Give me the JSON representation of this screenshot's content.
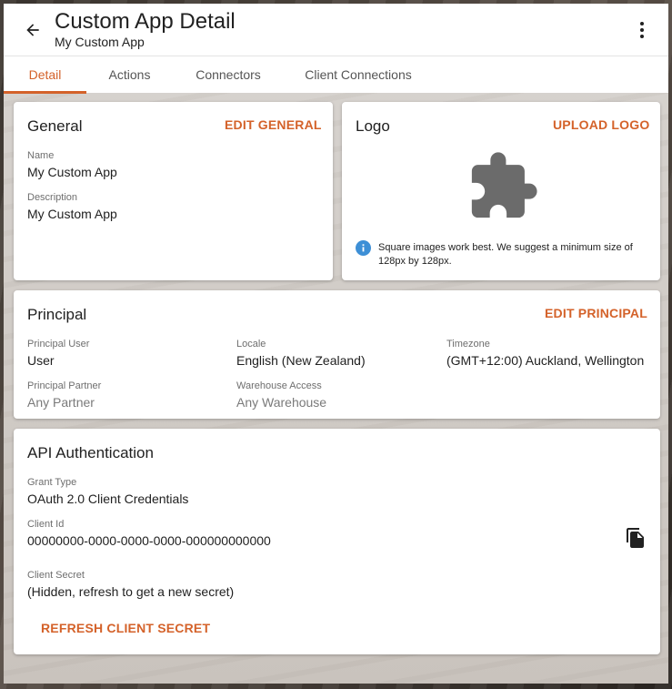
{
  "header": {
    "title": "Custom App Detail",
    "subtitle": "My Custom App"
  },
  "tabs": [
    {
      "label": "Detail",
      "active": true
    },
    {
      "label": "Actions",
      "active": false
    },
    {
      "label": "Connectors",
      "active": false
    },
    {
      "label": "Client Connections",
      "active": false
    }
  ],
  "general": {
    "title": "General",
    "action": "EDIT GENERAL",
    "name_label": "Name",
    "name_value": "My Custom App",
    "description_label": "Description",
    "description_value": "My Custom App"
  },
  "logo": {
    "title": "Logo",
    "action": "UPLOAD LOGO",
    "placeholder_icon": "extension-puzzle-icon",
    "hint": "Square images work best. We suggest a minimum size of 128px by 128px."
  },
  "principal": {
    "title": "Principal",
    "action": "EDIT PRINCIPAL",
    "user_label": "Principal User",
    "user_value": "User",
    "locale_label": "Locale",
    "locale_value": "English (New Zealand)",
    "timezone_label": "Timezone",
    "timezone_value": "(GMT+12:00) Auckland, Wellington",
    "partner_label": "Principal Partner",
    "partner_value": "Any Partner",
    "warehouse_label": "Warehouse Access",
    "warehouse_value": "Any Warehouse"
  },
  "api": {
    "title": "API Authentication",
    "grant_label": "Grant Type",
    "grant_value": "OAuth 2.0 Client Credentials",
    "client_id_label": "Client Id",
    "client_id_value": "00000000-0000-0000-0000-000000000000",
    "secret_label": "Client Secret",
    "secret_value": "(Hidden, refresh to get a new secret)",
    "refresh_action": "REFRESH CLIENT SECRET"
  },
  "colors": {
    "accent": "#d4622a",
    "info": "#3d8fd6",
    "icon": "#6b6b6b"
  }
}
